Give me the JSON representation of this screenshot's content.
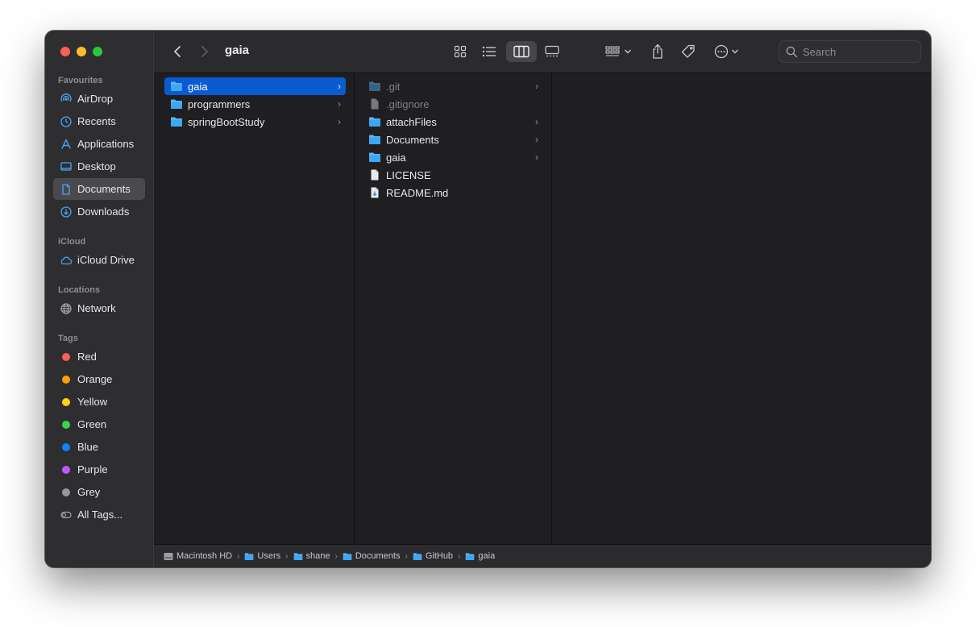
{
  "window": {
    "title": "gaia"
  },
  "sidebar": {
    "favourites_label": "Favourites",
    "favourites": [
      {
        "label": "AirDrop",
        "icon": "airdrop-icon"
      },
      {
        "label": "Recents",
        "icon": "clock-icon"
      },
      {
        "label": "Applications",
        "icon": "applications-icon"
      },
      {
        "label": "Desktop",
        "icon": "desktop-icon"
      },
      {
        "label": "Documents",
        "icon": "document-icon",
        "active": true
      },
      {
        "label": "Downloads",
        "icon": "download-icon"
      }
    ],
    "icloud_label": "iCloud",
    "icloud": [
      {
        "label": "iCloud Drive",
        "icon": "cloud-icon"
      }
    ],
    "locations_label": "Locations",
    "locations": [
      {
        "label": "Network",
        "icon": "globe-icon"
      }
    ],
    "tags_label": "Tags",
    "tags": [
      {
        "label": "Red",
        "color": "#ff5f57"
      },
      {
        "label": "Orange",
        "color": "#ff9f0a"
      },
      {
        "label": "Yellow",
        "color": "#ffd60a"
      },
      {
        "label": "Green",
        "color": "#32d74b"
      },
      {
        "label": "Blue",
        "color": "#0a84ff"
      },
      {
        "label": "Purple",
        "color": "#bf5af2"
      },
      {
        "label": "Grey",
        "color": "#98989d"
      },
      {
        "label": "All Tags..."
      }
    ]
  },
  "toolbar": {
    "search_placeholder": "Search"
  },
  "columns": {
    "col1": [
      {
        "name": "gaia",
        "type": "folder",
        "selected": true,
        "has_children": true
      },
      {
        "name": "programmers",
        "type": "folder",
        "has_children": true
      },
      {
        "name": "springBootStudy",
        "type": "folder",
        "has_children": true
      }
    ],
    "col2": [
      {
        "name": ".git",
        "type": "folder",
        "dim": true,
        "has_children": true
      },
      {
        "name": ".gitignore",
        "type": "file",
        "dim": true
      },
      {
        "name": "attachFiles",
        "type": "folder",
        "has_children": true
      },
      {
        "name": "Documents",
        "type": "folder",
        "has_children": true
      },
      {
        "name": "gaia",
        "type": "folder",
        "has_children": true
      },
      {
        "name": "LICENSE",
        "type": "file"
      },
      {
        "name": "README.md",
        "type": "markdown-file"
      }
    ]
  },
  "pathbar": [
    "Macintosh HD",
    "Users",
    "shane",
    "Documents",
    "GitHub",
    "gaia"
  ],
  "colors": {
    "accent": "#0a5ad1",
    "folder": "#3ea6f4"
  }
}
